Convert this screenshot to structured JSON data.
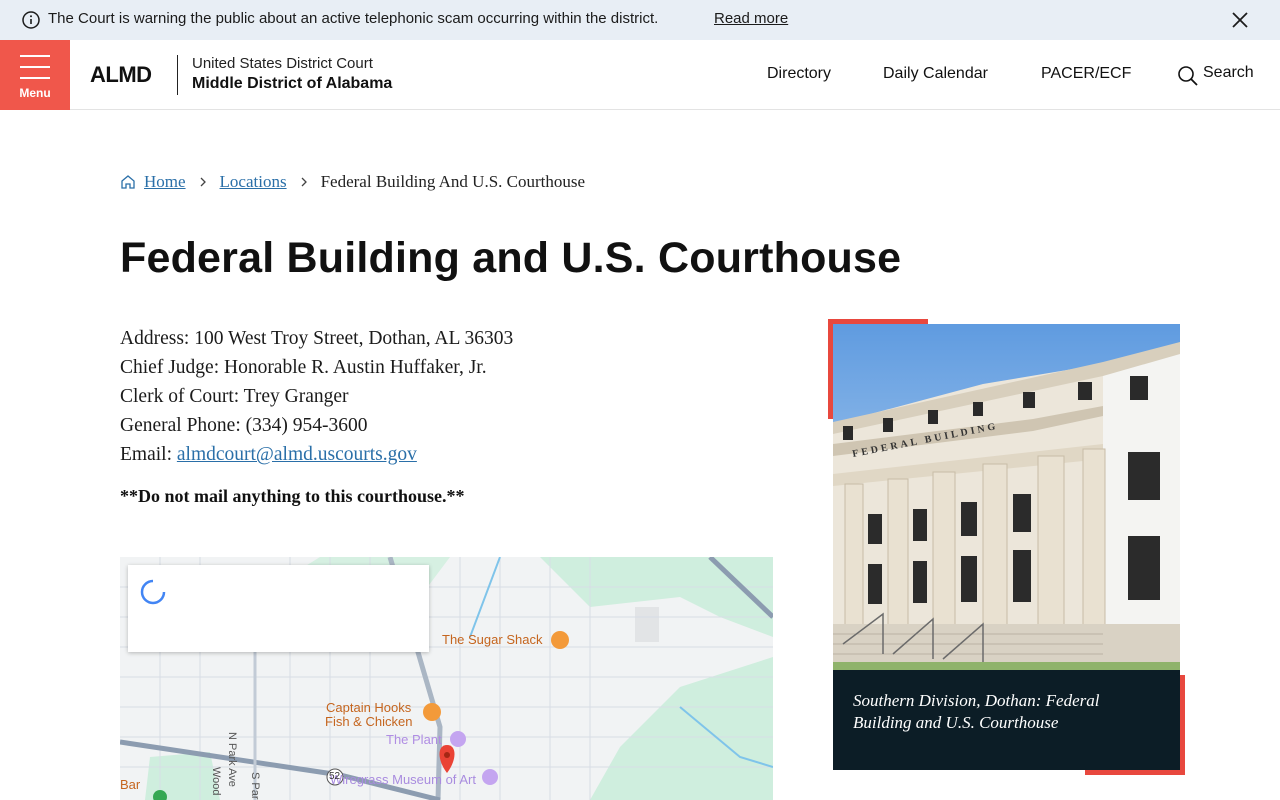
{
  "alert": {
    "message": "The Court is warning the public about an active telephonic scam occurring within the district.",
    "link": "Read more"
  },
  "header": {
    "menu_label": "Menu",
    "logo": "ALMD",
    "court_line1": "United States District Court",
    "court_line2": "Middle District of Alabama",
    "nav": [
      "Directory",
      "Daily Calendar",
      "PACER/ECF"
    ],
    "search_label": "Search"
  },
  "breadcrumb": {
    "home": "Home",
    "locations": "Locations",
    "current": "Federal Building And U.S. Courthouse"
  },
  "page": {
    "title": "Federal Building and U.S. Courthouse",
    "address": "Address: 100 West Troy Street, Dothan, AL 36303",
    "chief_judge": "Chief Judge: Honorable R. Austin Huffaker, Jr.",
    "clerk": "Clerk of Court: Trey Granger",
    "phone": "General Phone: (334) 954-3600",
    "email_label": "Email: ",
    "email": "almdcourt@almd.uscourts.gov",
    "warning": "**Do not mail anything to this courthouse.**"
  },
  "map": {
    "places": [
      "The Sugar Shack",
      "Captain Hooks",
      "Fish & Chicken",
      "The Plant",
      "Wiregrass Museum of Art",
      "Bar"
    ],
    "streets": [
      "N Park Ave",
      "S Park",
      "Wood",
      "52"
    ]
  },
  "figure": {
    "building_sign": "FEDERAL BUILDING",
    "caption": "Southern Division, Dothan: Federal Building and U.S. Courthouse"
  },
  "colors": {
    "accent": "#f0574b",
    "link": "#2a6fa8",
    "alert_bg": "#e8eef5",
    "caption_bg": "#0c1d26"
  }
}
